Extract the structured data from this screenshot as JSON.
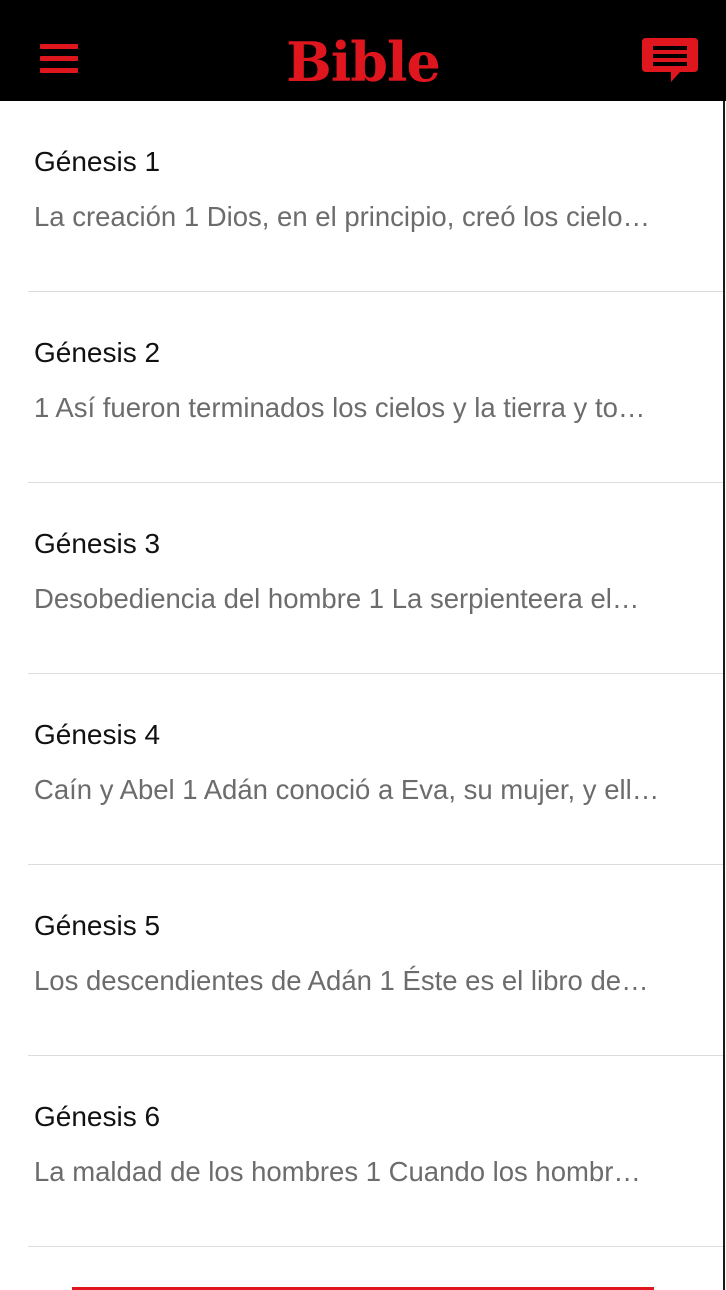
{
  "header": {
    "title": "Bible",
    "accent_color": "#e0161e",
    "background_color": "#000000",
    "menu_icon": "hamburger-menu-icon",
    "chat_icon": "chat-bubble-icon"
  },
  "chapters": [
    {
      "title": "Génesis 1",
      "preview": "La creación 1 Dios, en el principio, creó los cielo…"
    },
    {
      "title": "Génesis 2",
      "preview": "1 Así fueron terminados los cielos y la tierra y to…"
    },
    {
      "title": "Génesis 3",
      "preview": "Desobediencia del hombre 1 La serpienteera el…"
    },
    {
      "title": "Génesis 4",
      "preview": "Caín y Abel 1 Adán conoció a Eva, su mujer, y ell…"
    },
    {
      "title": "Génesis 5",
      "preview": "Los descendientes de Adán 1 Éste es el libro de…"
    },
    {
      "title": "Génesis 6",
      "preview": "La maldad de los hombres 1 Cuando los hombr…"
    }
  ]
}
